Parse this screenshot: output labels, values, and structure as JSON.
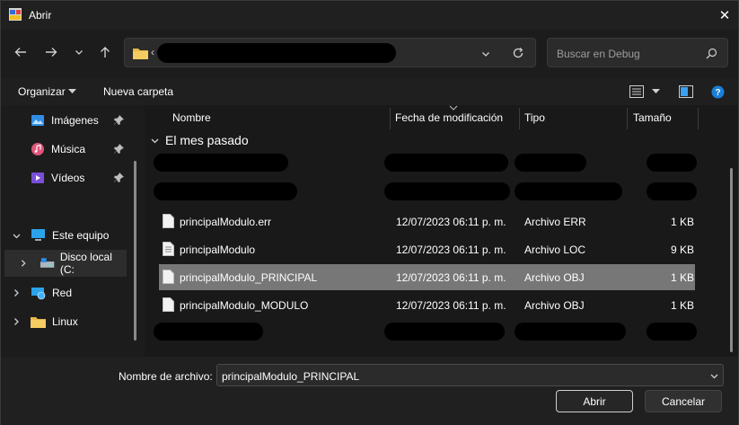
{
  "window": {
    "title": "Abrir",
    "close_glyph": "✕"
  },
  "nav": {
    "back_icon": "arrow-left-icon",
    "forward_icon": "arrow-right-icon",
    "recent_icon": "chevron-down-icon",
    "up_icon": "arrow-up-icon",
    "address_prefix": "‹",
    "search_placeholder": "Buscar en Debug"
  },
  "toolbar": {
    "organize_label": "Organizar",
    "new_folder_label": "Nueva carpeta"
  },
  "sidebar": {
    "items": [
      {
        "label": "Imágenes",
        "icon": "pictures-icon",
        "pinned": true
      },
      {
        "label": "Música",
        "icon": "music-icon",
        "pinned": true
      },
      {
        "label": "Vídeos",
        "icon": "videos-icon",
        "pinned": true
      },
      {
        "label": "Este equipo",
        "icon": "computer-icon",
        "expanded": true
      },
      {
        "label": "Disco local (C:",
        "icon": "drive-icon",
        "selected": true
      },
      {
        "label": "Red",
        "icon": "network-icon"
      },
      {
        "label": "Linux",
        "icon": "folder-icon"
      }
    ]
  },
  "columns": {
    "name": "Nombre",
    "modified": "Fecha de modificación",
    "type": "Tipo",
    "size": "Tamaño"
  },
  "group": {
    "label": "El mes pasado"
  },
  "files": [
    {
      "name": "principalModulo.err",
      "modified": "12/07/2023 06:11 p. m.",
      "type": "Archivo ERR",
      "size": "1 KB",
      "selected": false
    },
    {
      "name": "principalModulo",
      "modified": "12/07/2023 06:11 p. m.",
      "type": "Archivo LOC",
      "size": "9 KB",
      "selected": false
    },
    {
      "name": "principalModulo_PRINCIPAL",
      "modified": "12/07/2023 06:11 p. m.",
      "type": "Archivo OBJ",
      "size": "1 KB",
      "selected": true
    },
    {
      "name": "principalModulo_MODULO",
      "modified": "12/07/2023 06:11 p. m.",
      "type": "Archivo OBJ",
      "size": "1 KB",
      "selected": false
    }
  ],
  "bottom": {
    "filename_label": "Nombre de archivo:",
    "filename_value": "principalModulo_PRINCIPAL",
    "open_label": "Abrir",
    "cancel_label": "Cancelar"
  },
  "colors": {
    "accent_selection": "#777777",
    "background": "#191919",
    "folder": "#f2c55c"
  }
}
